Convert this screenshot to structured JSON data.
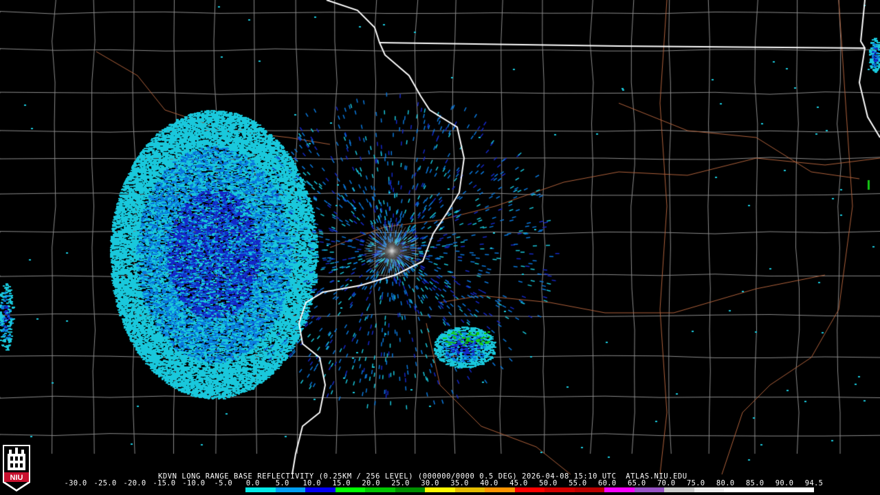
{
  "product_title": "KDVN LONG RANGE BASE REFLECTIVITY (0.25KM / 256 LEVEL) (000000/0000 0.5 DEG) 2026-04-08 15:10 UTC  ATLAS.NIU.EDU",
  "logo_text": "NIU",
  "colorbar": {
    "labels": [
      "-30.0",
      "-25.0",
      "-20.0",
      "-15.0",
      "-10.0",
      "-5.0",
      "0.0",
      "5.0",
      "10.0",
      "15.0",
      "20.0",
      "25.0",
      "30.0",
      "35.0",
      "40.0",
      "45.0",
      "50.0",
      "55.0",
      "60.0",
      "65.0",
      "70.0",
      "75.0",
      "80.0",
      "85.0",
      "90.0",
      "94.5"
    ],
    "colors": [
      "#000000",
      "#000000",
      "#000000",
      "#000000",
      "#000000",
      "#000000",
      "#04e9e7",
      "#019ff4",
      "#0300f4",
      "#02fd02",
      "#01c501",
      "#008e00",
      "#fdf802",
      "#e5bc00",
      "#fd9500",
      "#fd0000",
      "#d40000",
      "#bc0000",
      "#f800fd",
      "#9854c6",
      "#cccccc",
      "#eeeeee",
      "#ffffff",
      "#ffffff",
      "#ffffff"
    ]
  },
  "map_colors": {
    "background": "#000000",
    "state_border": "#ffffff",
    "county_lines": "#8c8c8c",
    "highways": "#b0623c",
    "echo_light": "#19c8dc",
    "echo_medium": "#0a78dc",
    "echo_strong": "#1428c8",
    "echo_green": "#14c814"
  }
}
